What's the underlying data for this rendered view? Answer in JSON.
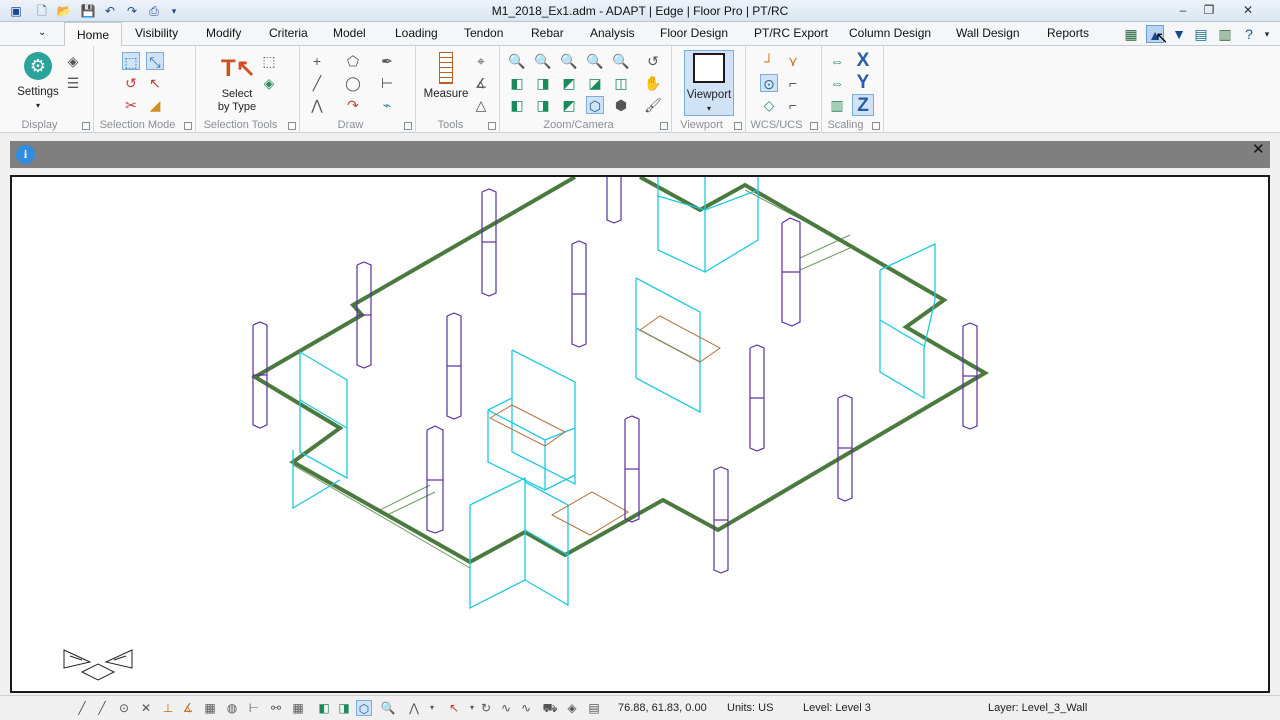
{
  "window": {
    "title": "M1_2018_Ex1.adm - ADAPT | Edge | Floor Pro | PT/RC",
    "controls": {
      "minimize": "–",
      "restore": "❐",
      "close": "✕"
    }
  },
  "quick_access": {
    "icons": [
      "new-file-icon",
      "open-folder-icon",
      "save-icon",
      "undo-icon",
      "redo-icon",
      "print-icon",
      "customize-arrow-icon"
    ]
  },
  "tabs": [
    {
      "label": "Home",
      "active": true
    },
    {
      "label": "Visibility"
    },
    {
      "label": "Modify"
    },
    {
      "label": "Criteria"
    },
    {
      "label": "Model"
    },
    {
      "label": "Loading"
    },
    {
      "label": "Tendon"
    },
    {
      "label": "Rebar"
    },
    {
      "label": "Analysis"
    },
    {
      "label": "Floor Design"
    },
    {
      "label": "PT/RC Export"
    },
    {
      "label": "Column Design"
    },
    {
      "label": "Wall Design"
    },
    {
      "label": "Reports"
    }
  ],
  "ribbon": {
    "groups": {
      "display": "Display",
      "selection_mode": "Selection Mode",
      "selection_tools": "Selection Tools",
      "draw": "Draw",
      "tools": "Tools",
      "zoom_camera": "Zoom/Camera",
      "viewport": "Viewport",
      "wcs_ucs": "WCS/UCS",
      "scaling": "Scaling"
    },
    "buttons": {
      "settings": "Settings",
      "select_by_type_line1": "Select",
      "select_by_type_line2": "by Type",
      "measure": "Measure",
      "viewport": "Viewport"
    },
    "scaling_axes": [
      "X",
      "Y",
      "Z"
    ]
  },
  "info_bar": {
    "icon": "i",
    "close": "✕"
  },
  "status": {
    "coordinates": "76.88, 61.83, 0.00",
    "units": "Units: US",
    "level": "Level: Level 3",
    "layer": "Layer: Level_3_Wall"
  },
  "colors": {
    "slab_edge": "#4a7a3e",
    "column": "#5b2ea0",
    "wall": "#1ec8e0",
    "opening": "#b8703a"
  }
}
